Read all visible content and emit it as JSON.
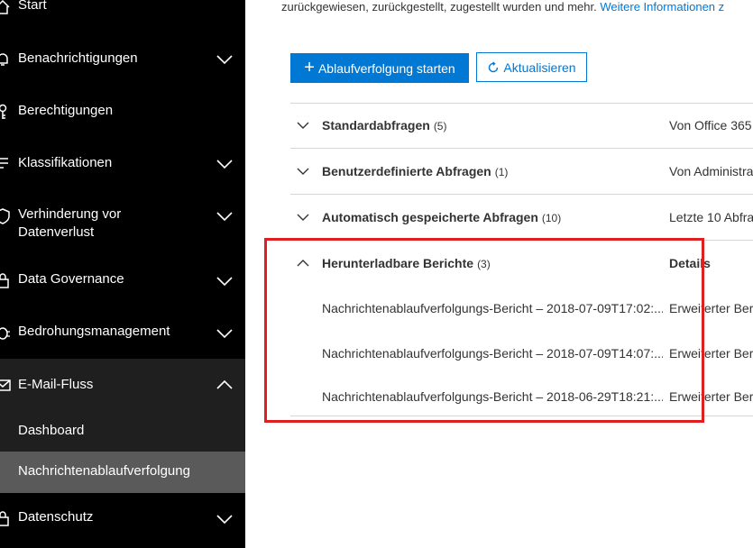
{
  "sidebar": {
    "items": [
      {
        "label": "Start",
        "icon": "home-icon"
      },
      {
        "label": "Benachrichtigungen",
        "icon": "bell-icon"
      },
      {
        "label": "Berechtigungen",
        "icon": "person-key-icon"
      },
      {
        "label": "Klassifikationen",
        "icon": "list-tag-icon"
      },
      {
        "label": "Verhinderung vor Datenverlust",
        "icon": "shield-icon"
      },
      {
        "label": "Data Governance",
        "icon": "lock-icon"
      },
      {
        "label": "Bedrohungsmanagement",
        "icon": "bug-icon"
      },
      {
        "label": "E-Mail-Fluss",
        "icon": "mail-icon"
      },
      {
        "label": "Datenschutz",
        "icon": "lock-icon"
      }
    ],
    "subitems": [
      {
        "label": "Dashboard"
      },
      {
        "label": "Nachrichtenablaufverfolgung"
      }
    ]
  },
  "main": {
    "intro_text": "zurückgewiesen, zurückgestellt, zugestellt wurden und mehr.",
    "intro_link": "Weitere Informationen z",
    "start_button": "Ablaufverfolgung starten",
    "refresh_button": "Aktualisieren",
    "groups": [
      {
        "title": "Standardabfragen",
        "count": "(5)",
        "col": "Von Office 365"
      },
      {
        "title": "Benutzerdefinierte Abfragen",
        "count": "(1)",
        "col": "Von Administra"
      },
      {
        "title": "Automatisch gespeicherte Abfragen",
        "count": "(10)",
        "col": "Letzte 10 Abfra"
      },
      {
        "title": "Herunterladbare Berichte",
        "count": "(3)",
        "col": "Details"
      }
    ],
    "reports": [
      {
        "name": "Nachrichtenablaufverfolgungs-Bericht – 2018-07-09T17:02:...",
        "detail": "Erweiterter Beri"
      },
      {
        "name": "Nachrichtenablaufverfolgungs-Bericht – 2018-07-09T14:07:...",
        "detail": "Erweiterter Beri"
      },
      {
        "name": "Nachrichtenablaufverfolgungs-Bericht – 2018-06-29T18:21:...",
        "detail": "Erweiterter Beri"
      }
    ]
  },
  "colors": {
    "sidebar_bg": "#000000",
    "active_item_bg": "#5a5a5a",
    "accent": "#0078d4",
    "highlight": "#e02020"
  }
}
